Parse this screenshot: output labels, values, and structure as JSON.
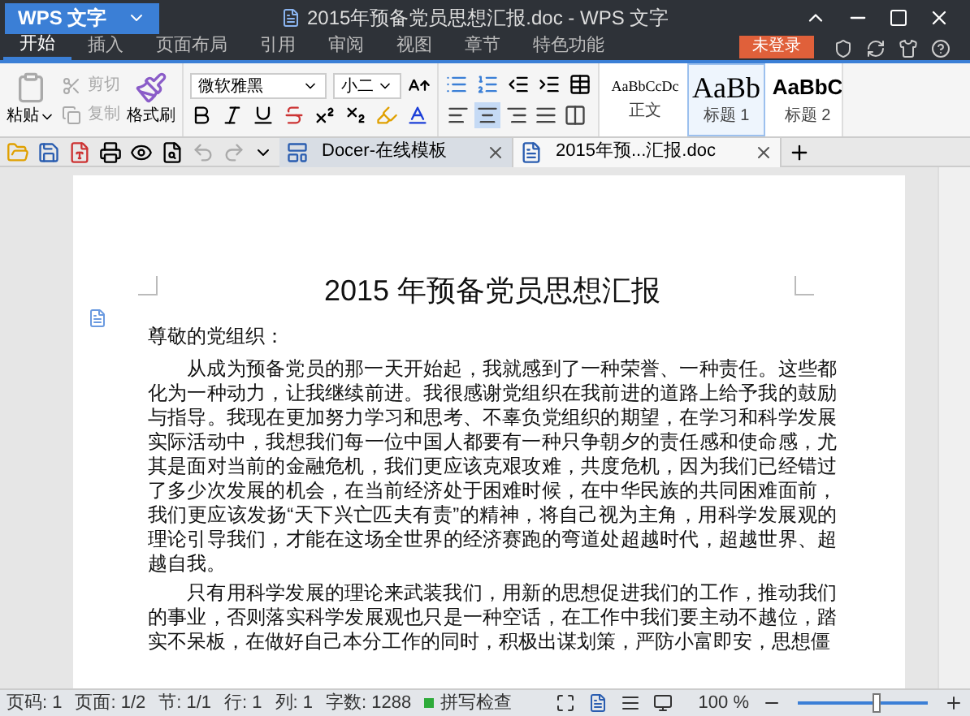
{
  "app_button": "WPS 文字",
  "window": {
    "title": "2015年预备党员思想汇报.doc - WPS 文字"
  },
  "menu_tabs": [
    {
      "label": "开始",
      "selected": true
    },
    {
      "label": "插入",
      "selected": false
    },
    {
      "label": "页面布局",
      "selected": false
    },
    {
      "label": "引用",
      "selected": false
    },
    {
      "label": "审阅",
      "selected": false
    },
    {
      "label": "视图",
      "selected": false
    },
    {
      "label": "章节",
      "selected": false
    },
    {
      "label": "特色功能",
      "selected": false
    }
  ],
  "login_button": "未登录",
  "ribbon": {
    "paste": "粘贴",
    "cut": {
      "label": "剪切",
      "disabled": true
    },
    "copy": {
      "label": "复制",
      "disabled": true
    },
    "format_painter": "格式刷",
    "font": "微软雅黑",
    "size": "小二",
    "align": [
      {
        "selected": false
      },
      {
        "selected": true
      },
      {
        "selected": false
      },
      {
        "selected": false
      },
      {
        "selected": false
      }
    ],
    "styles": [
      {
        "sample": "AaBbCcDc",
        "label": "正文",
        "selected": false
      },
      {
        "sample": "AaBb",
        "label": "标题 1",
        "selected": true
      },
      {
        "sample": "AaBbC",
        "label": "标题 2",
        "selected": false
      }
    ]
  },
  "doc_tabs": [
    {
      "label": "Docer-在线模板",
      "selected": false
    },
    {
      "label": "2015年预...汇报.doc",
      "selected": true
    }
  ],
  "document": {
    "title": "2015 年预备党员思想汇报",
    "salutation": "尊敬的党组织：",
    "paragraphs": [
      "从成为预备党员的那一天开始起，我就感到了一种荣誉、一种责任。这些都化为一种动力，让我继续前进。我很感谢党组织在我前进的道路上给予我的鼓励与指导。我现在更加努力学习和思考、不辜负党组织的期望，在学习和科学发展实际活动中，我想我们每一位中国人都要有一种只争朝夕的责任感和使命感，尤其是面对当前的金融危机，我们更应该克艰攻难，共度危机，因为我们已经错过了多少次发展的机会，在当前经济处于困难时候，在中华民族的共同困难面前，我们更应该发扬“天下兴亡匹夫有责”的精神，将自己视为主角，用科学发展观的理论引导我们，才能在这场全世界的经济赛跑的弯道处超越时代，超越世界、超越自我。",
      "只有用科学发展的理论来武装我们，用新的思想促进我们的工作，推动我们的事业，否则落实科学发展观也只是一种空话，在工作中我们要主动不越位，踏实不呆板，在做好自己本分工作的同时，积极出谋划策，严防小富即安，思想僵"
    ]
  },
  "status_bar": {
    "items": [
      "页码: 1",
      "页面: 1/2",
      "节: 1/1",
      "行: 1",
      "列: 1",
      "字数: 1288"
    ],
    "spell_check": "拼写检查",
    "zoom": "100 %",
    "zoom_level": {
      "level": 0.6
    }
  }
}
